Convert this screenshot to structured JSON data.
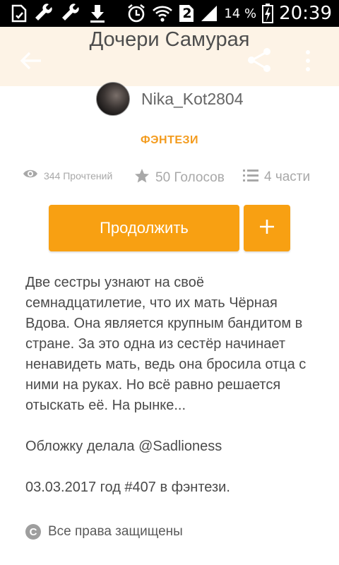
{
  "status_bar": {
    "icons_left": [
      "sim-card-icon",
      "wrench-icon",
      "wrench-icon",
      "download-icon"
    ],
    "icons_right": [
      "alarm-icon",
      "wifi-icon",
      "sim-2-icon",
      "signal-icon"
    ],
    "sim_label": "2",
    "battery_percent": "14 %",
    "time": "20:39"
  },
  "toolbar": {
    "title": "Дочери Самурая",
    "back_icon": "arrow-back-icon",
    "share_icon": "share-icon",
    "more_icon": "more-vertical-icon",
    "background": "#fdf3e6"
  },
  "author": {
    "name": "Nika_Kot2804"
  },
  "genre": "ФЭНТЕЗИ",
  "stats": {
    "reads": "344 Прочтений",
    "votes": "50 Голосов",
    "parts": "4 части"
  },
  "actions": {
    "continue_label": "Продолжить",
    "add_label": "+"
  },
  "description": {
    "summary": "Две сестры узнают на своё семнадцатилетие, что их мать Чёрная Вдова. Она является крупным бандитом в стране. За это одна из сестёр начинает ненавидеть мать, ведь она бросила отца с ними на руках. Но всё равно решается отыскать её. На рынке...",
    "cover_credit": "Обложку делала @Sadlioness",
    "rank_note": "03.03.2017 год #407 в фэнтези."
  },
  "copyright": {
    "symbol": "C",
    "text": "Все права защищены"
  },
  "colors": {
    "accent": "#f8a012",
    "genre": "#f39b1d"
  }
}
